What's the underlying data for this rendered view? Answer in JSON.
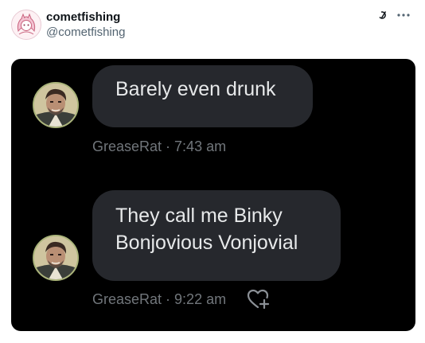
{
  "post": {
    "display_name": "cometfishing",
    "handle": "@cometfishing",
    "icons": [
      "grok-icon",
      "more-options-icon"
    ]
  },
  "chat": {
    "background": "#000000",
    "bubble_color": "#26282d",
    "messages": [
      {
        "lines": [
          "Barely even drunk"
        ],
        "sender": "GreaseRat",
        "separator": "·",
        "time": "7:43 am"
      },
      {
        "lines": [
          "They call me Binky",
          "Bonjovious Vonjovial"
        ],
        "sender": "GreaseRat",
        "separator": "·",
        "time": "9:22 am",
        "reaction_icon": "heart-add-icon"
      }
    ]
  }
}
